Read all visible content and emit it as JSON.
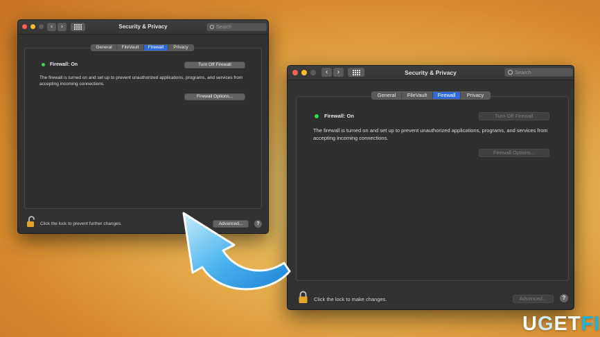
{
  "window_back": {
    "title": "Security & Privacy",
    "search_placeholder": "Search",
    "tabs": [
      {
        "label": "General",
        "active": false
      },
      {
        "label": "FileVault",
        "active": false
      },
      {
        "label": "Firewall",
        "active": true
      },
      {
        "label": "Privacy",
        "active": false
      }
    ],
    "firewall_status": "Firewall: On",
    "description": "The firewall is turned on and set up to prevent unauthorized applications, programs, and services from accepting incoming connections.",
    "toggle_button": "Turn Off Firewall",
    "options_button": "Firewall Options...",
    "lock_text": "Click the lock to prevent further changes.",
    "lock_state": "unlocked",
    "advanced_button": "Advanced...",
    "help": "?"
  },
  "window_front": {
    "title": "Security & Privacy",
    "search_placeholder": "Search",
    "tabs": [
      {
        "label": "General",
        "active": false
      },
      {
        "label": "FileVault",
        "active": false
      },
      {
        "label": "Firewall",
        "active": true
      },
      {
        "label": "Privacy",
        "active": false
      }
    ],
    "firewall_status": "Firewall: On",
    "description": "The firewall is turned on and set up to prevent unauthorized applications, programs, and services from accepting incoming connections.",
    "toggle_button": "Turn Off Firewall",
    "options_button": "Firewall Options...",
    "lock_text": "Click the lock to make changes.",
    "lock_state": "locked",
    "advanced_button": "Advanced...",
    "help": "?"
  },
  "watermark": {
    "u": "U",
    "g": "G",
    "et": "ET",
    "fix": "FIX"
  },
  "colors": {
    "accent": "#2f6ad8",
    "status_on": "#32d74b",
    "arrow": "#3aa0e8"
  },
  "icons": [
    "back-chevron-icon",
    "forward-chevron-icon",
    "show-all-grid-icon",
    "search-icon",
    "open-lock-icon",
    "closed-lock-icon",
    "help-icon",
    "curved-arrow-icon"
  ]
}
